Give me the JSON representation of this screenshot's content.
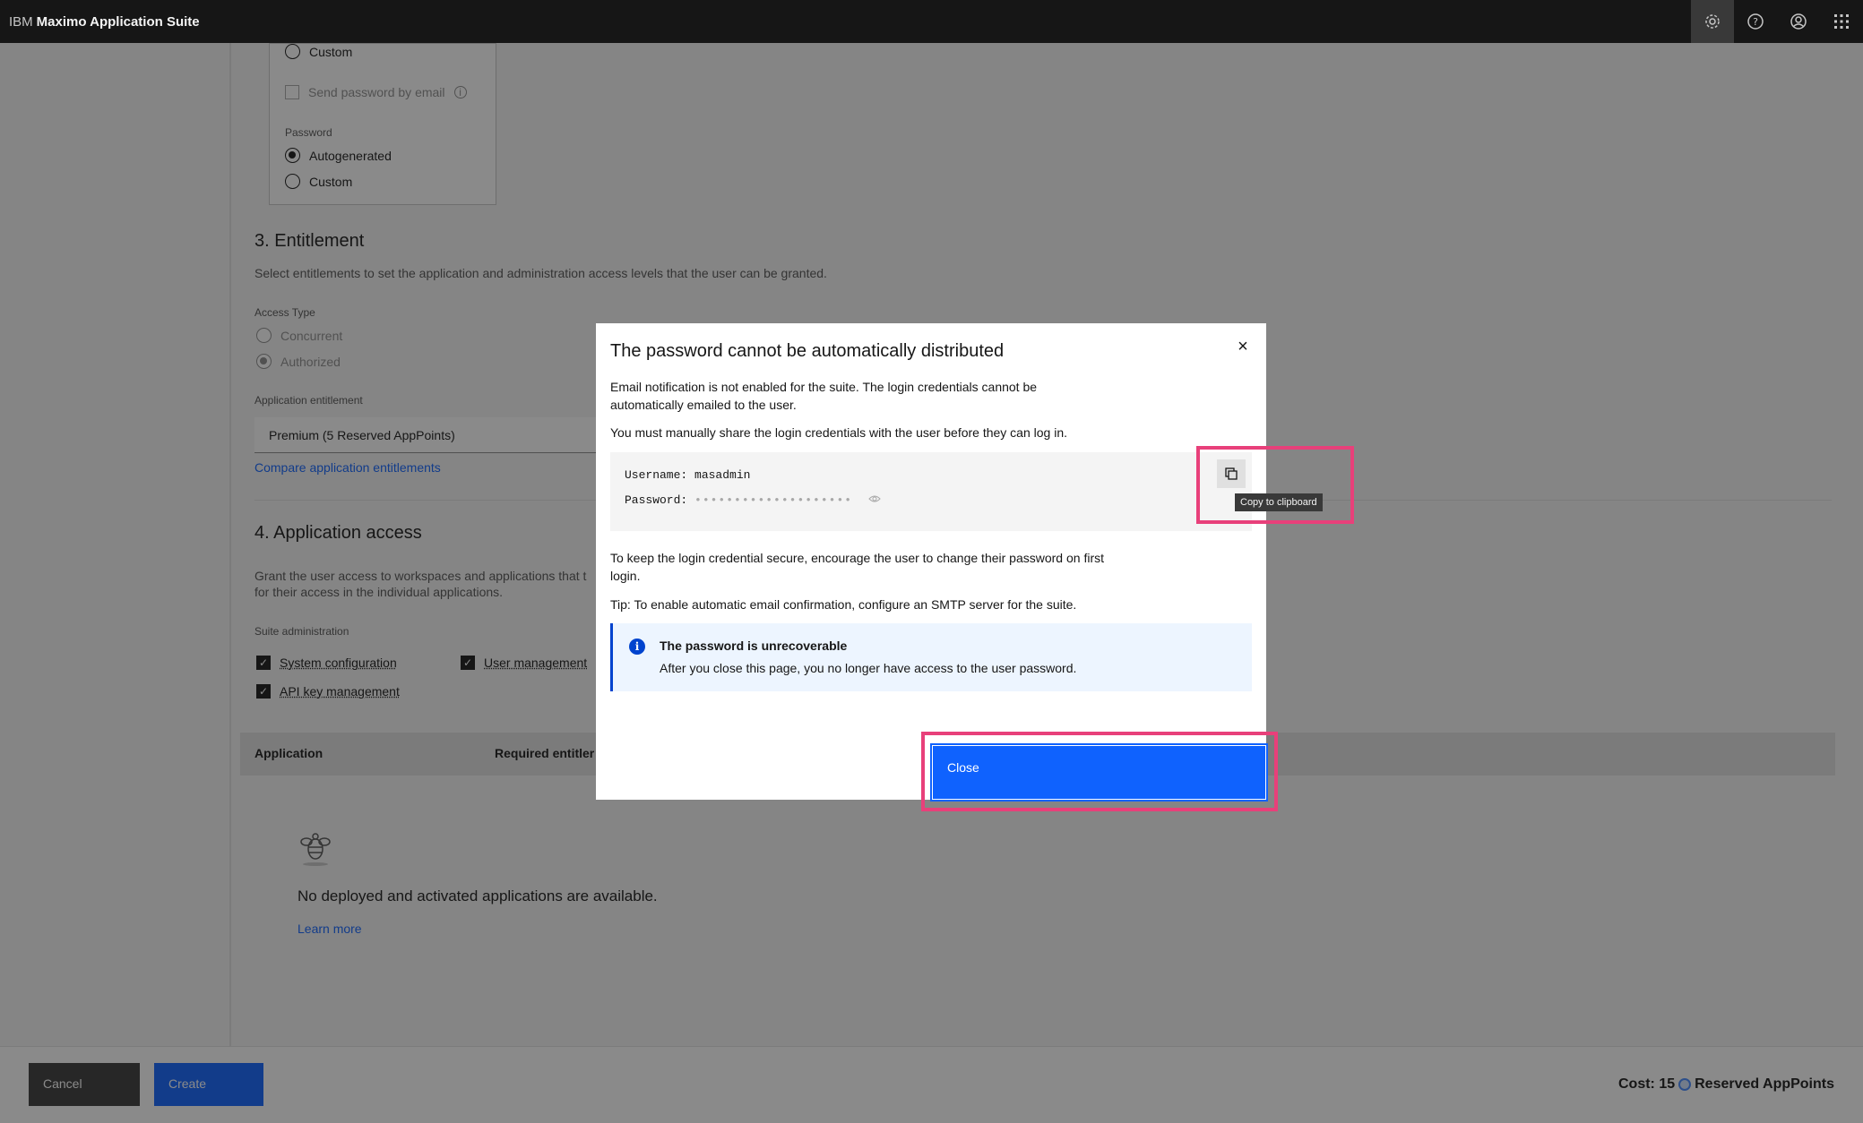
{
  "header": {
    "brand_prefix": "IBM",
    "brand_name": "Maximo Application Suite",
    "icons": [
      "gear-icon",
      "help-icon",
      "user-icon",
      "app-switcher-icon"
    ]
  },
  "form": {
    "username_option_custom": "Custom",
    "send_password_email": "Send password by email",
    "password_label": "Password",
    "password_options": [
      {
        "label": "Autogenerated",
        "selected": true
      },
      {
        "label": "Custom",
        "selected": false
      }
    ],
    "entitlement": {
      "heading": "3. Entitlement",
      "description": "Select entitlements to set the application and administration access levels that the user can be granted.",
      "access_type_label": "Access Type",
      "access_types": [
        {
          "label": "Concurrent",
          "selected": false
        },
        {
          "label": "Authorized",
          "selected": true
        }
      ],
      "app_entitlement_label": "Application entitlement",
      "app_entitlement_value": "Premium (5 Reserved AppPoints)",
      "compare_link": "Compare application entitlements"
    },
    "app_access": {
      "heading": "4. Application access",
      "description_line1": "Grant the user access to workspaces and applications that t",
      "description_line2": "for their access in the individual applications.",
      "suite_admin_label": "Suite administration",
      "checks": [
        {
          "label": "System configuration",
          "checked": true
        },
        {
          "label": "User management",
          "checked": true
        },
        {
          "label": "API key management",
          "checked": true
        }
      ],
      "table_headers": [
        "Application",
        "Required entitler"
      ],
      "empty_title": "No deployed and activated applications are available.",
      "learn_more": "Learn more"
    }
  },
  "footer": {
    "cancel_label": "Cancel",
    "create_label": "Create",
    "cost_prefix": "Cost: 15",
    "cost_suffix": "Reserved AppPoints"
  },
  "modal": {
    "title": "The password cannot be automatically distributed",
    "close_icon": "×",
    "para1_line1": "Email notification is not enabled for the suite. The login credentials cannot be",
    "para1_line2": "automatically emailed to the user.",
    "para2": "You must manually share the login credentials with the user before they can log in.",
    "username_label": "Username:",
    "username_value": "masadmin",
    "password_label": "Password:",
    "password_mask": "••••••••••••••••••••",
    "copy_tooltip": "Copy to clipboard",
    "para3_line1": "To keep the login credential secure, encourage the user to change their password on first",
    "para3_line2": "login.",
    "tip": "Tip: To enable automatic email confirmation, configure an SMTP server for the suite.",
    "notice_icon": "i",
    "notice_title": "The password is unrecoverable",
    "notice_body": "After you close this page, you no longer have access to the user password.",
    "close_button": "Close"
  },
  "colors": {
    "primary": "#0f62fe",
    "highlight": "#e8407a",
    "topbar": "#161616"
  }
}
